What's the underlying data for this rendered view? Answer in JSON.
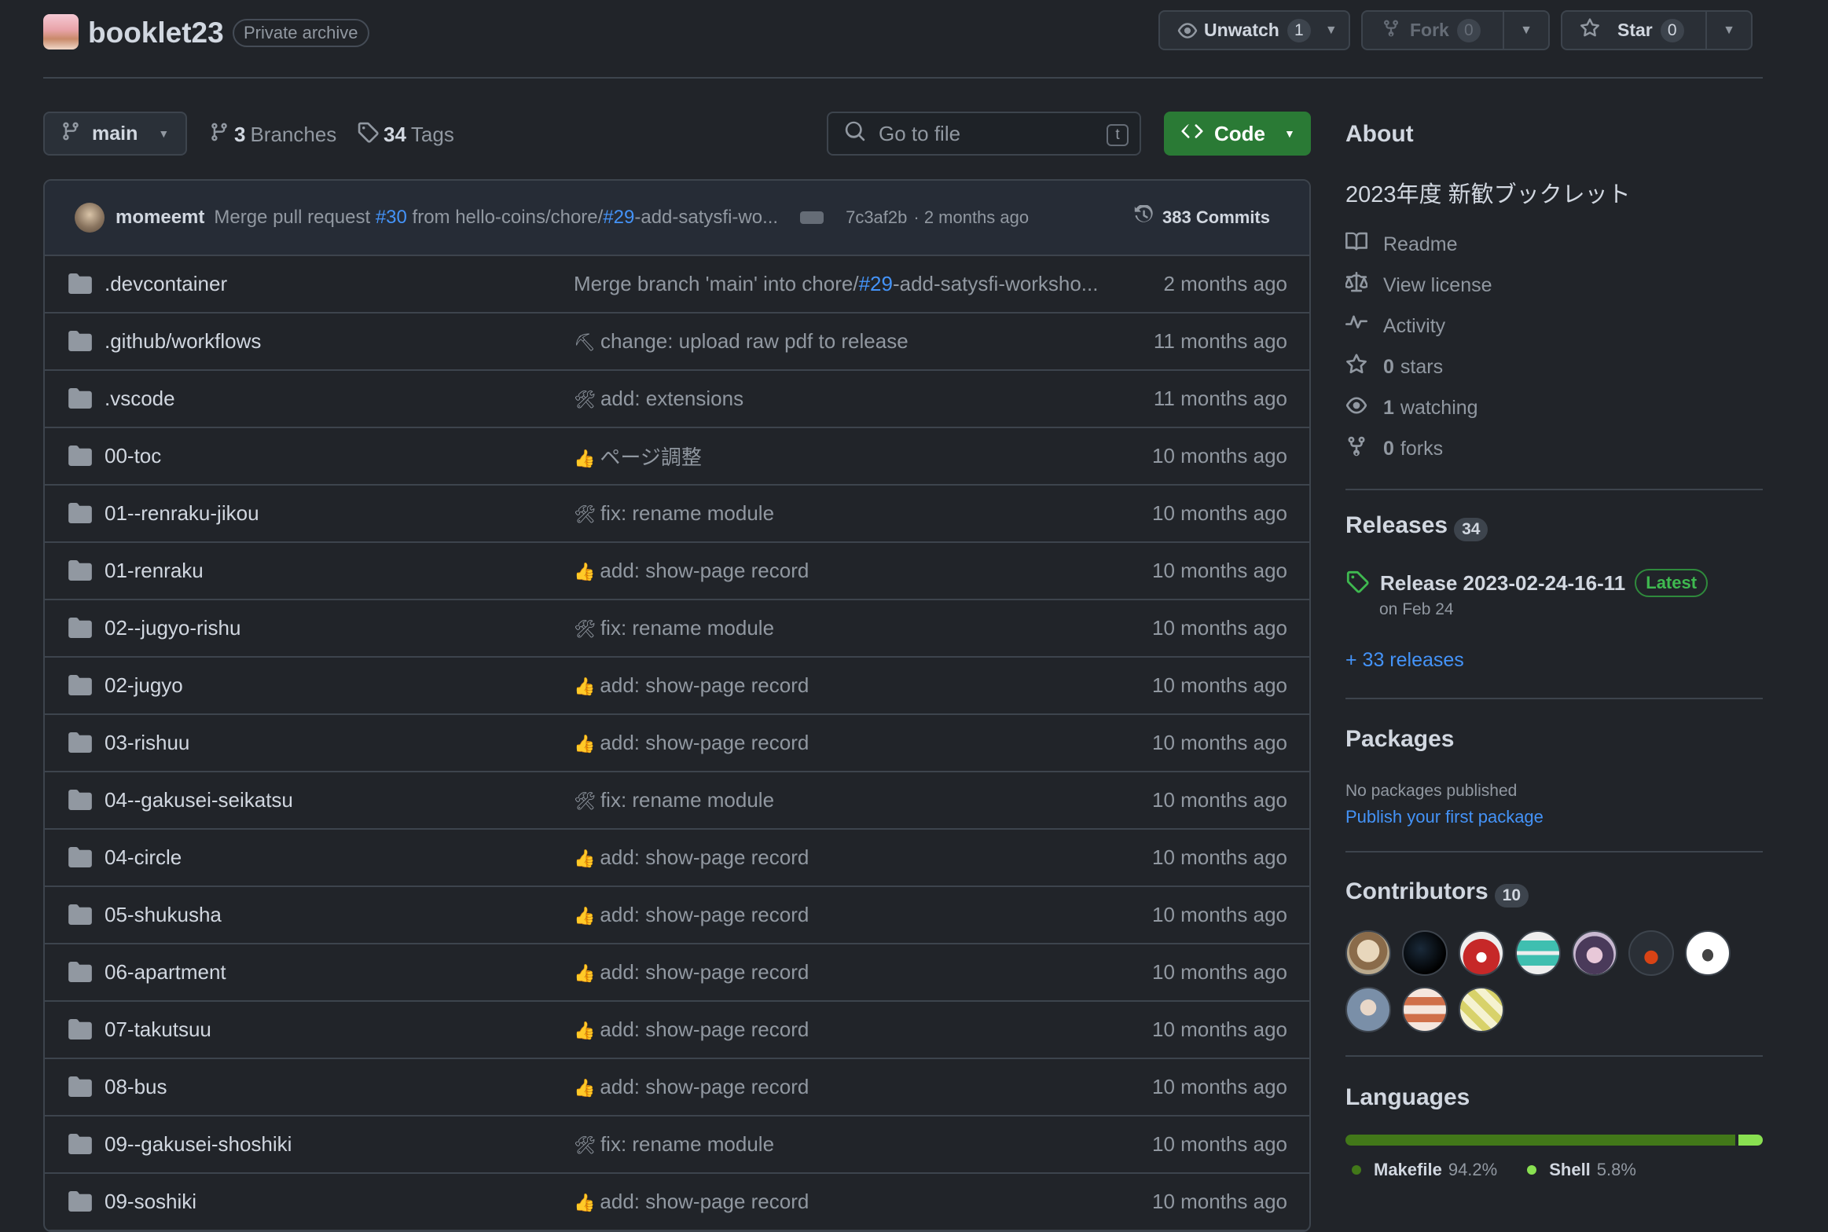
{
  "repo": {
    "name": "booklet23",
    "visibility": "Private archive"
  },
  "header_actions": {
    "unwatch_label": "Unwatch",
    "unwatch_count": "1",
    "fork_label": "Fork",
    "fork_count": "0",
    "star_label": "Star",
    "star_count": "0"
  },
  "toolbar": {
    "branch": "main",
    "branches_count": "3",
    "branches_label": "Branches",
    "tags_count": "34",
    "tags_label": "Tags",
    "search_placeholder": "Go to file",
    "search_shortcut": "t",
    "code_label": "Code"
  },
  "latest_commit": {
    "author": "momeemt",
    "msg_a": "Merge pull request ",
    "pr": "#30",
    "msg_b": " from hello-coins/chore/",
    "issue": "#29",
    "msg_c": "-add-satysfi-wo...",
    "hash": "7c3af2b",
    "time": "· 2 months ago",
    "commits": "383 Commits"
  },
  "files": [
    {
      "name": ".devcontainer",
      "emoji": "",
      "msg": "Merge branch 'main' into chore/",
      "msg_link": "#29",
      "msg_tail": "-add-satysfi-worksho...",
      "when": "2 months ago"
    },
    {
      "name": ".github/workflows",
      "emoji": "⛏",
      "msg": "change: upload raw pdf to release",
      "msg_link": "",
      "msg_tail": "",
      "when": "11 months ago"
    },
    {
      "name": ".vscode",
      "emoji": "🛠",
      "msg": "add: extensions",
      "msg_link": "",
      "msg_tail": "",
      "when": "11 months ago"
    },
    {
      "name": "00-toc",
      "emoji": "👍",
      "msg": "ページ調整",
      "msg_link": "",
      "msg_tail": "",
      "when": "10 months ago"
    },
    {
      "name": "01--renraku-jikou",
      "emoji": "🛠",
      "msg": "fix: rename module",
      "msg_link": "",
      "msg_tail": "",
      "when": "10 months ago"
    },
    {
      "name": "01-renraku",
      "emoji": "👍",
      "msg": "add: show-page record",
      "msg_link": "",
      "msg_tail": "",
      "when": "10 months ago"
    },
    {
      "name": "02--jugyo-rishu",
      "emoji": "🛠",
      "msg": "fix: rename module",
      "msg_link": "",
      "msg_tail": "",
      "when": "10 months ago"
    },
    {
      "name": "02-jugyo",
      "emoji": "👍",
      "msg": "add: show-page record",
      "msg_link": "",
      "msg_tail": "",
      "when": "10 months ago"
    },
    {
      "name": "03-rishuu",
      "emoji": "👍",
      "msg": "add: show-page record",
      "msg_link": "",
      "msg_tail": "",
      "when": "10 months ago"
    },
    {
      "name": "04--gakusei-seikatsu",
      "emoji": "🛠",
      "msg": "fix: rename module",
      "msg_link": "",
      "msg_tail": "",
      "when": "10 months ago"
    },
    {
      "name": "04-circle",
      "emoji": "👍",
      "msg": "add: show-page record",
      "msg_link": "",
      "msg_tail": "",
      "when": "10 months ago"
    },
    {
      "name": "05-shukusha",
      "emoji": "👍",
      "msg": "add: show-page record",
      "msg_link": "",
      "msg_tail": "",
      "when": "10 months ago"
    },
    {
      "name": "06-apartment",
      "emoji": "👍",
      "msg": "add: show-page record",
      "msg_link": "",
      "msg_tail": "",
      "when": "10 months ago"
    },
    {
      "name": "07-takutsuu",
      "emoji": "👍",
      "msg": "add: show-page record",
      "msg_link": "",
      "msg_tail": "",
      "when": "10 months ago"
    },
    {
      "name": "08-bus",
      "emoji": "👍",
      "msg": "add: show-page record",
      "msg_link": "",
      "msg_tail": "",
      "when": "10 months ago"
    },
    {
      "name": "09--gakusei-shoshiki",
      "emoji": "🛠",
      "msg": "fix: rename module",
      "msg_link": "",
      "msg_tail": "",
      "when": "10 months ago"
    },
    {
      "name": "09-soshiki",
      "emoji": "👍",
      "msg": "add: show-page record",
      "msg_link": "",
      "msg_tail": "",
      "when": "10 months ago"
    }
  ],
  "about": {
    "title": "About",
    "description": "2023年度 新歓ブックレット",
    "readme": "Readme",
    "license": "View license",
    "activity": "Activity",
    "stars_n": "0",
    "stars_label": "stars",
    "watching_n": "1",
    "watching_label": "watching",
    "forks_n": "0",
    "forks_label": "forks"
  },
  "releases": {
    "title": "Releases",
    "count": "34",
    "latest_name": "Release 2023-02-24-16-11",
    "latest_badge": "Latest",
    "latest_date": "on Feb 24",
    "more": "+ 33 releases"
  },
  "packages": {
    "title": "Packages",
    "none": "No packages published",
    "publish": "Publish your first package"
  },
  "contributors": {
    "title": "Contributors",
    "count": "10"
  },
  "languages": {
    "title": "Languages",
    "items": [
      {
        "name": "Makefile",
        "pct": "94.2%",
        "value": 94.2,
        "color": "#427819"
      },
      {
        "name": "Shell",
        "pct": "5.8%",
        "value": 5.8,
        "color": "#89e051"
      }
    ]
  }
}
